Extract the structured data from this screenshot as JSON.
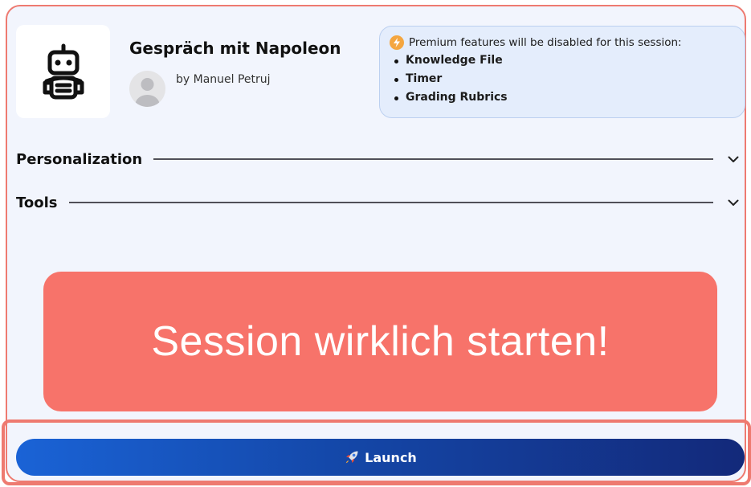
{
  "header": {
    "title": "Gespräch mit Napoleon",
    "author": "by Manuel Petruj"
  },
  "premium": {
    "heading": "Premium features will be disabled for this session:",
    "items": [
      "Knowledge File",
      "Timer",
      "Grading Rubrics"
    ]
  },
  "sections": [
    {
      "label": "Personalization"
    },
    {
      "label": "Tools"
    }
  ],
  "overlay": {
    "text": "Session wirklich starten!"
  },
  "launch": {
    "label": "Launch",
    "icon": "rocket-icon"
  },
  "colors": {
    "frame_border": "#ee7a70",
    "overlay": "#f7736a",
    "launch_start": "#1a63d6",
    "launch_end": "#13297a",
    "premium_bg": "#e4edfc",
    "bolt": "#f4a640"
  }
}
